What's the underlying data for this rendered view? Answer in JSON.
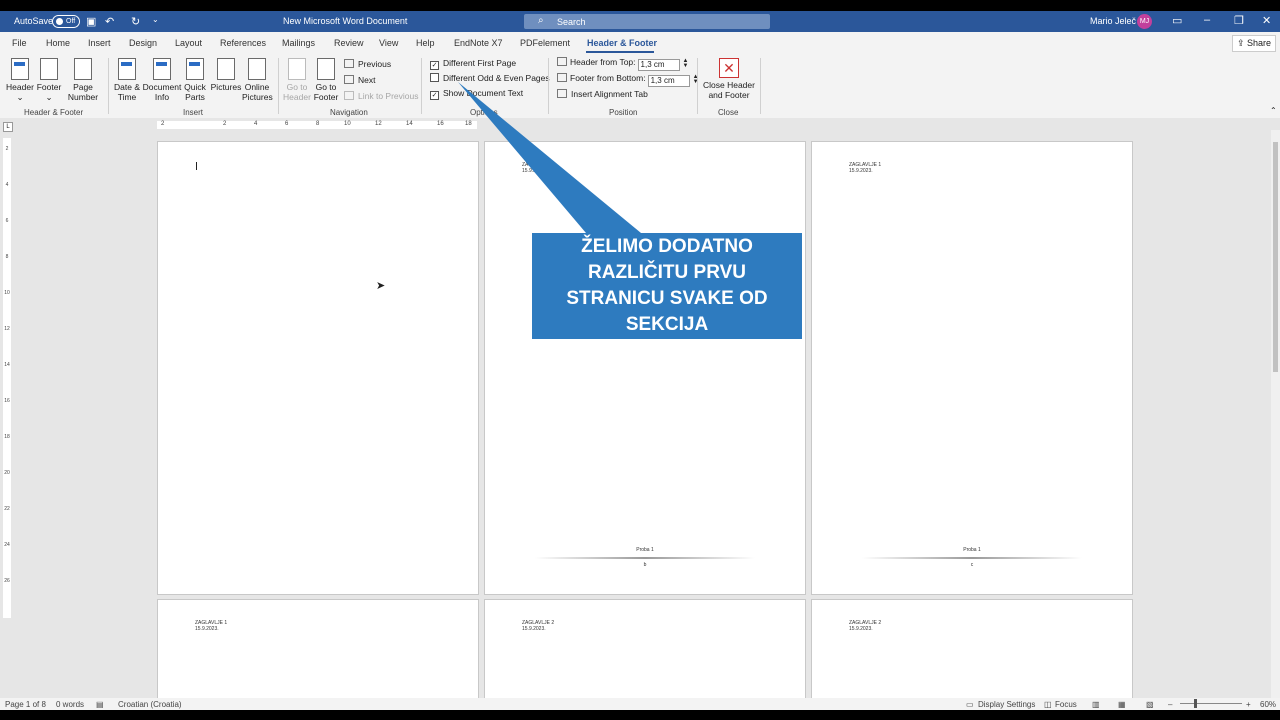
{
  "titlebar": {
    "autosave_label": "AutoSave",
    "autosave_state": "Off",
    "document_title": "New Microsoft Word Document",
    "search_placeholder": "Search",
    "user_name": "Mario Jeleč",
    "user_initials": "MJ"
  },
  "tabs": [
    {
      "label": "File"
    },
    {
      "label": "Home"
    },
    {
      "label": "Insert"
    },
    {
      "label": "Design"
    },
    {
      "label": "Layout"
    },
    {
      "label": "References"
    },
    {
      "label": "Mailings"
    },
    {
      "label": "Review"
    },
    {
      "label": "View"
    },
    {
      "label": "Help"
    },
    {
      "label": "EndNote X7"
    },
    {
      "label": "PDFelement"
    },
    {
      "label": "Header & Footer"
    }
  ],
  "share_label": "Share",
  "ribbon": {
    "header_footer_group": {
      "label": "Header & Footer",
      "header": "Header",
      "footer": "Footer",
      "page_number_1": "Page",
      "page_number_2": "Number"
    },
    "insert_group": {
      "label": "Insert",
      "date_time_1": "Date &",
      "date_time_2": "Time",
      "document_info_1": "Document",
      "document_info_2": "Info",
      "quick_parts_1": "Quick",
      "quick_parts_2": "Parts",
      "pictures": "Pictures",
      "online_pictures_1": "Online",
      "online_pictures_2": "Pictures"
    },
    "navigation_group": {
      "label": "Navigation",
      "go_to_header_1": "Go to",
      "go_to_header_2": "Header",
      "go_to_footer_1": "Go to",
      "go_to_footer_2": "Footer",
      "previous": "Previous",
      "next": "Next",
      "link_to_previous": "Link to Previous"
    },
    "options_group": {
      "label": "Options",
      "different_first_page": "Different First Page",
      "different_odd_even": "Different Odd & Even Pages",
      "show_document_text": "Show Document Text"
    },
    "position_group": {
      "label": "Position",
      "header_from_top": "Header from Top:",
      "header_from_top_value": "1,3 cm",
      "footer_from_bottom": "Footer from Bottom:",
      "footer_from_bottom_value": "1,3 cm",
      "insert_alignment_tab": "Insert Alignment Tab"
    },
    "close_group": {
      "label": "Close",
      "close_1": "Close Header",
      "close_2": "and Footer"
    }
  },
  "ruler": {
    "ticks": [
      "2",
      "2",
      "4",
      "6",
      "8",
      "10",
      "12",
      "14",
      "16",
      "18"
    ],
    "vticks": [
      "2",
      "4",
      "6",
      "8",
      "10",
      "12",
      "14",
      "16",
      "18",
      "20",
      "22",
      "24",
      "26"
    ]
  },
  "pages": [
    {
      "header_1": "",
      "header_2": "",
      "footer_label": "",
      "footer_letter": ""
    },
    {
      "header_1": "ZAGLAVLJE 1",
      "header_2": "15.9.2023.",
      "footer_label": "Proba 1",
      "footer_letter": "b"
    },
    {
      "header_1": "ZAGLAVLJE 1",
      "header_2": "15.9.2023.",
      "footer_label": "Proba 1",
      "footer_letter": "c"
    },
    {
      "header_1": "ZAGLAVLJE 1",
      "header_2": "15.9.2023."
    },
    {
      "header_1": "ZAGLAVLJE 2",
      "header_2": "15.9.2023."
    },
    {
      "header_1": "ZAGLAVLJE 2",
      "header_2": "15.9.2023."
    }
  ],
  "callout": {
    "line_1": "ŽELIMO DODATNO",
    "line_2": "RAZLIČITU PRVU",
    "line_3": "STRANICU SVAKE OD",
    "line_4": "SEKCIJA",
    "color": "#2e7bbf"
  },
  "statusbar": {
    "page_count": "Page 1 of 8",
    "word_count": "0 words",
    "language": "Croatian (Croatia)",
    "display_settings": "Display Settings",
    "focus": "Focus",
    "zoom": "60%"
  },
  "colors": {
    "accent": "#2b579a"
  }
}
